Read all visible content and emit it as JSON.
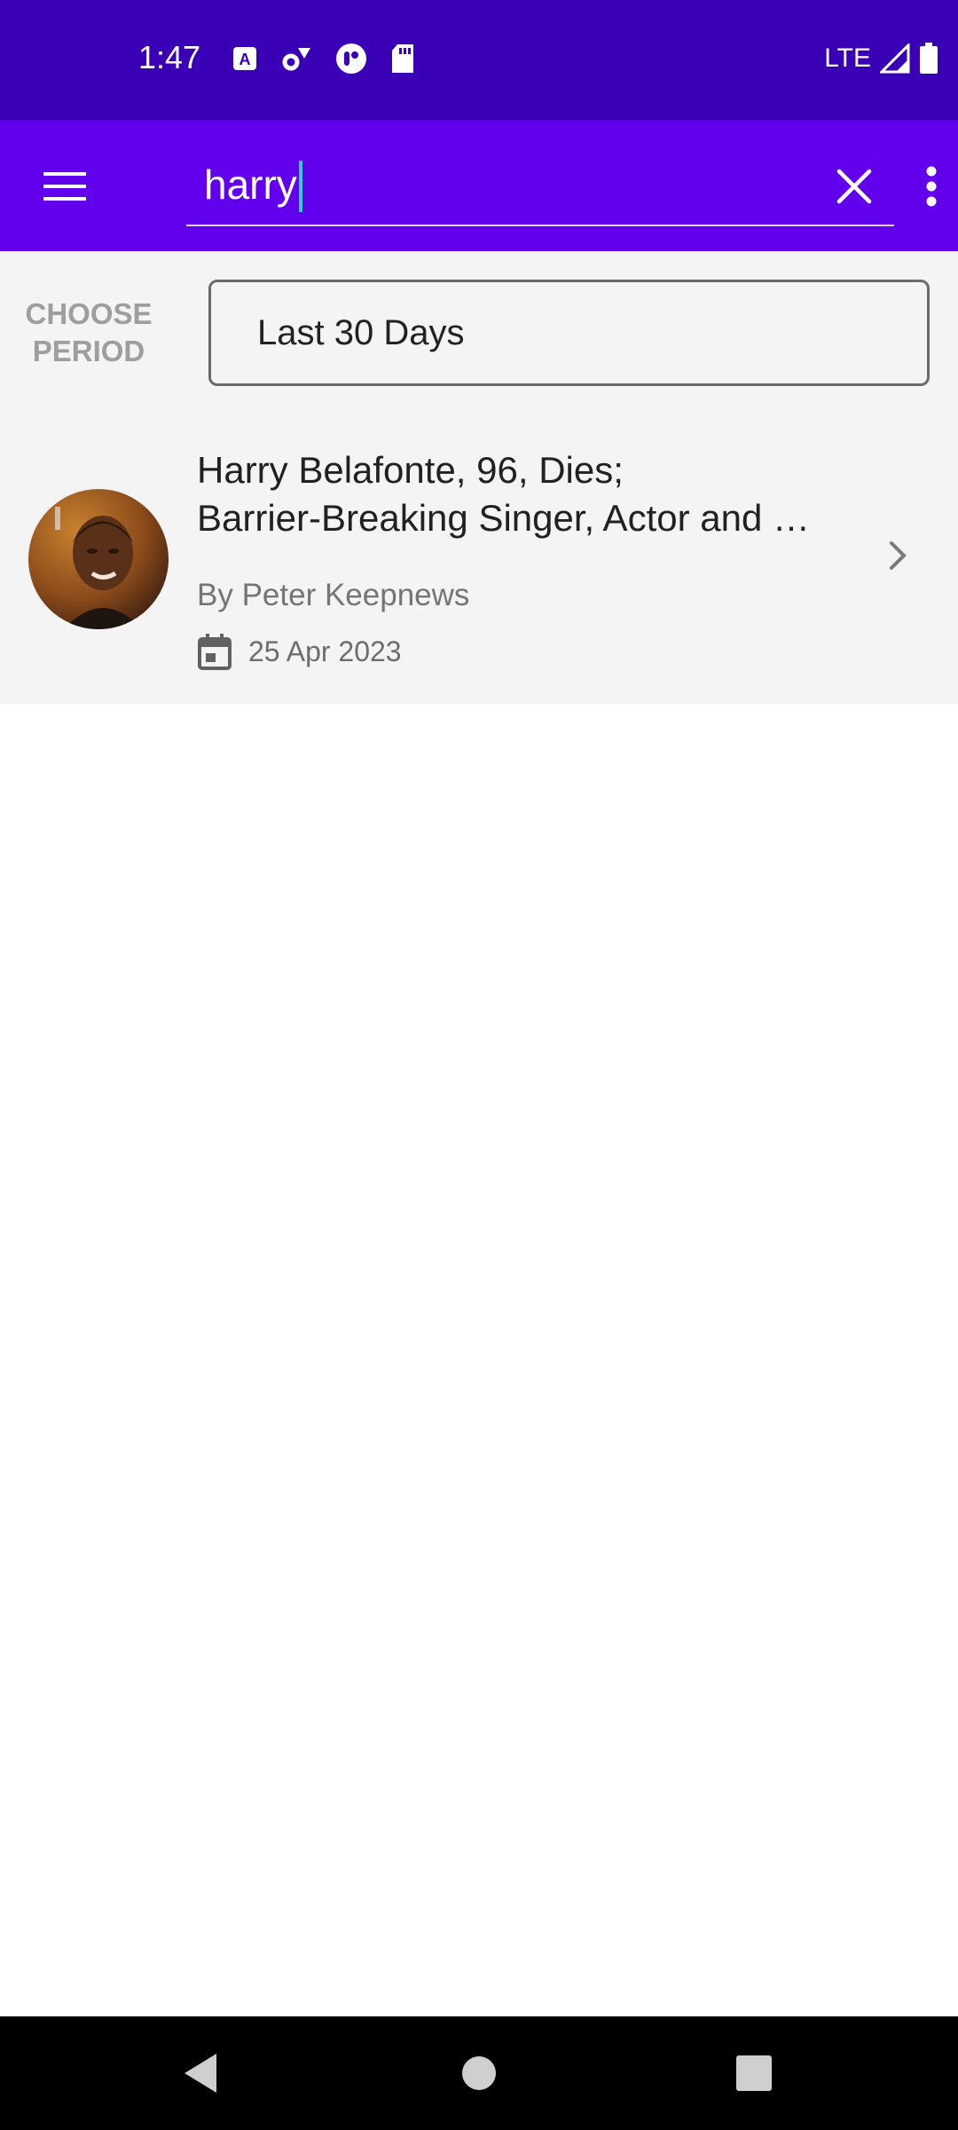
{
  "status_bar": {
    "time": "1:47",
    "network": "LTE",
    "icons": [
      "text-a-icon",
      "gear-icon",
      "record-icon",
      "sd-card-icon",
      "signal-icon",
      "battery-icon"
    ]
  },
  "app_bar": {
    "background": "#6200ee",
    "search_value": "harry",
    "icons": [
      "hamburger-menu-icon",
      "close-icon",
      "more-vertical-icon"
    ]
  },
  "filter": {
    "label_line1": "CHOOSE",
    "label_line2": "PERIOD",
    "selected_period": "Last 30 Days"
  },
  "results": [
    {
      "title_line1": "Harry Belafonte, 96, Dies;",
      "title_line2": "Barrier-Breaking Singer, Actor and …",
      "author": "By Peter Keepnews",
      "date": "25 Apr 2023"
    }
  ],
  "nav_bar": {
    "icons": [
      "back-icon",
      "home-icon",
      "recents-icon"
    ]
  }
}
